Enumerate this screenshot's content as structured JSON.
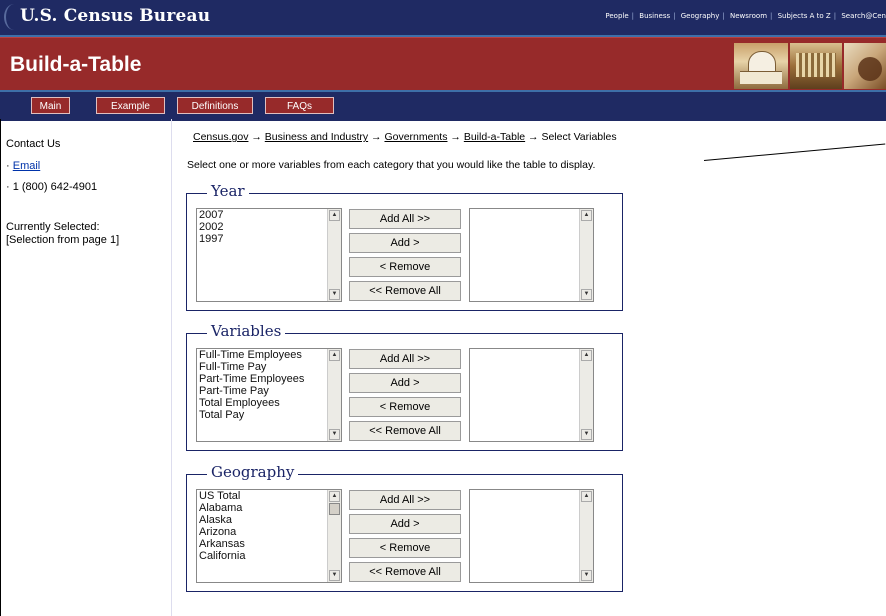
{
  "header": {
    "logo_text": "U.S. Census Bureau",
    "links": [
      "People",
      "Business",
      "Geography",
      "Newsroom",
      "Subjects A to Z",
      "Search@Cen"
    ]
  },
  "title": "Build-a-Table",
  "nav": [
    "Main",
    "Example",
    "Definitions",
    "FAQs"
  ],
  "sidebar": {
    "contact": "Contact Us",
    "email_bullet": "·",
    "email": "Email",
    "phone": "· 1 (800) 642-4901",
    "selected_label": "Currently Selected:",
    "selected_value": "[Selection from page 1]"
  },
  "breadcrumb": {
    "items": [
      "Census.gov",
      "Business and Industry",
      "Governments",
      "Build-a-Table"
    ],
    "current": "Select Variables",
    "arrow": "→"
  },
  "instruction": "Select one or more variables from each category that you would like the table to display.",
  "buttons": {
    "add_all": "Add All >>",
    "add": "Add >",
    "remove": "< Remove",
    "remove_all": "<< Remove All"
  },
  "year": {
    "legend": "Year",
    "options": [
      "2007",
      "2002",
      "1997"
    ]
  },
  "variables": {
    "legend": "Variables",
    "options": [
      "Full-Time Employees",
      "Full-Time Pay",
      "Part-Time Employees",
      "Part-Time Pay",
      "Total Employees",
      "Total Pay"
    ]
  },
  "geography": {
    "legend": "Geography",
    "options": [
      "US Total",
      "Alabama",
      "Alaska",
      "Arizona",
      "Arkansas",
      "California"
    ]
  }
}
